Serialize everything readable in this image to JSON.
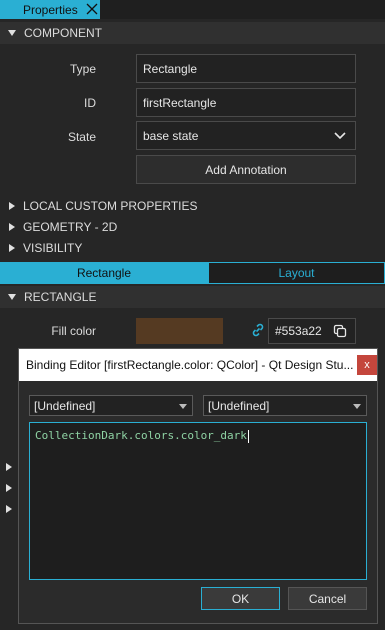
{
  "tab": {
    "label": "Properties"
  },
  "sections": {
    "component": "COMPONENT",
    "local_custom": "LOCAL CUSTOM PROPERTIES",
    "geometry": "GEOMETRY - 2D",
    "visibility": "VISIBILITY",
    "rectangle": "RECTANGLE"
  },
  "component": {
    "type_label": "Type",
    "type_value": "Rectangle",
    "id_label": "ID",
    "id_value": "firstRectangle",
    "state_label": "State",
    "state_value": "base state",
    "annotation_button": "Add Annotation"
  },
  "segments": {
    "rectangle": "Rectangle",
    "layout": "Layout"
  },
  "fill": {
    "label": "Fill color",
    "hex": "#553a22",
    "color": "#553a22"
  },
  "dialog": {
    "title": "Binding Editor [firstRectangle.color: QColor] - Qt Design Stu...",
    "close": "x",
    "combo_left": "[Undefined]",
    "combo_right": "[Undefined]",
    "expression": "CollectionDark.colors.color_dark",
    "ok": "OK",
    "cancel": "Cancel"
  },
  "colors": {
    "accent": "#2aafd3",
    "background": "#262626"
  }
}
